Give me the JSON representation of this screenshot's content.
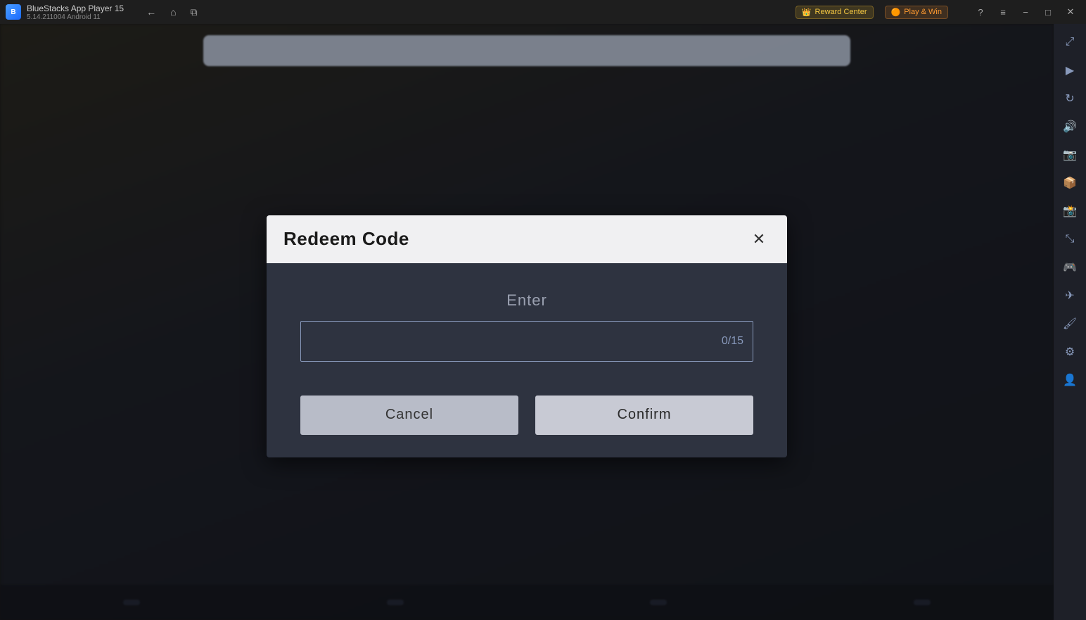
{
  "titlebar": {
    "logo_text": "B",
    "app_name": "BlueStacks App Player 15",
    "app_version": "5.14.211004  Android 11",
    "nav": {
      "back_icon": "←",
      "home_icon": "⌂",
      "copy_icon": "⧉"
    },
    "reward_center_label": "Reward Center",
    "reward_icon": "👑",
    "play_win_label": "Play & Win",
    "play_win_icon": "🟠",
    "help_icon": "?",
    "menu_icon": "≡",
    "minimize_icon": "−",
    "maximize_icon": "□",
    "close_icon": "✕",
    "fullscreen_icon": "⛶"
  },
  "sidebar": {
    "icons": [
      {
        "name": "expand-icon",
        "glyph": "⤢"
      },
      {
        "name": "arrow-right-icon",
        "glyph": "▶"
      },
      {
        "name": "rotate-icon",
        "glyph": "↻"
      },
      {
        "name": "volume-icon",
        "glyph": "🔊"
      },
      {
        "name": "camera-icon",
        "glyph": "📷"
      },
      {
        "name": "apk-icon",
        "glyph": "📦"
      },
      {
        "name": "screenshot-icon",
        "glyph": "📸"
      },
      {
        "name": "resize-icon",
        "glyph": "⤡"
      },
      {
        "name": "gamepad-icon",
        "glyph": "🎮"
      },
      {
        "name": "airplane-icon",
        "glyph": "✈"
      },
      {
        "name": "brush-icon",
        "glyph": "🖌"
      },
      {
        "name": "settings-icon",
        "glyph": "⚙"
      },
      {
        "name": "user-icon",
        "glyph": "👤"
      }
    ]
  },
  "dialog": {
    "title": "Redeem Code",
    "close_icon": "✕",
    "enter_label": "Enter",
    "input_placeholder": "",
    "input_counter": "0/15",
    "cancel_label": "Cancel",
    "confirm_label": "Confirm"
  },
  "bottom_items": [
    {
      "label": "◀   BACK"
    },
    {
      "label": "▲  LEVEL"
    },
    {
      "label": "●   MAP"
    },
    {
      "label": "■   MENU"
    }
  ]
}
